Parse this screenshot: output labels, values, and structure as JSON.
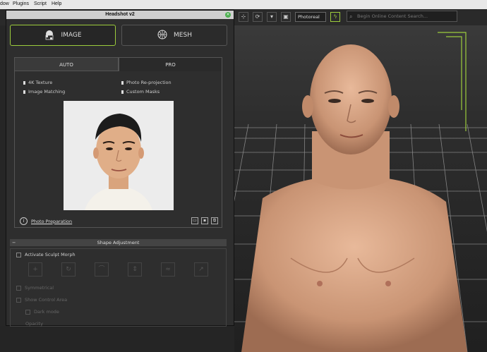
{
  "menubar": {
    "items": [
      "dow",
      "Plugins",
      "Script",
      "Help"
    ]
  },
  "panel": {
    "title": "Headshot v2",
    "close_icon": "close-icon",
    "modes": {
      "image_label": "IMAGE",
      "mesh_label": "MESH"
    },
    "tabs": {
      "auto": "AUTO",
      "pro": "PRO"
    },
    "features": {
      "f1": "4K Texture",
      "f2": "Photo Re-projection",
      "f3": "Image Matching",
      "f4": "Custom Masks"
    },
    "photo_prep_label": "Photo Preparation",
    "shape_section_title": "Shape Adjustment",
    "sculpt_label": "Activate Sculpt Morph",
    "symmetric_label": "Symmetrical",
    "control_area_label": "Show Control Area",
    "dark_mode_label": "Dark mode",
    "last_option_label": "Opacity"
  },
  "viewport": {
    "render_mode": "Photoreal",
    "search_placeholder": "Begin Online Content Search...",
    "accent_color": "#9ccc3c"
  }
}
